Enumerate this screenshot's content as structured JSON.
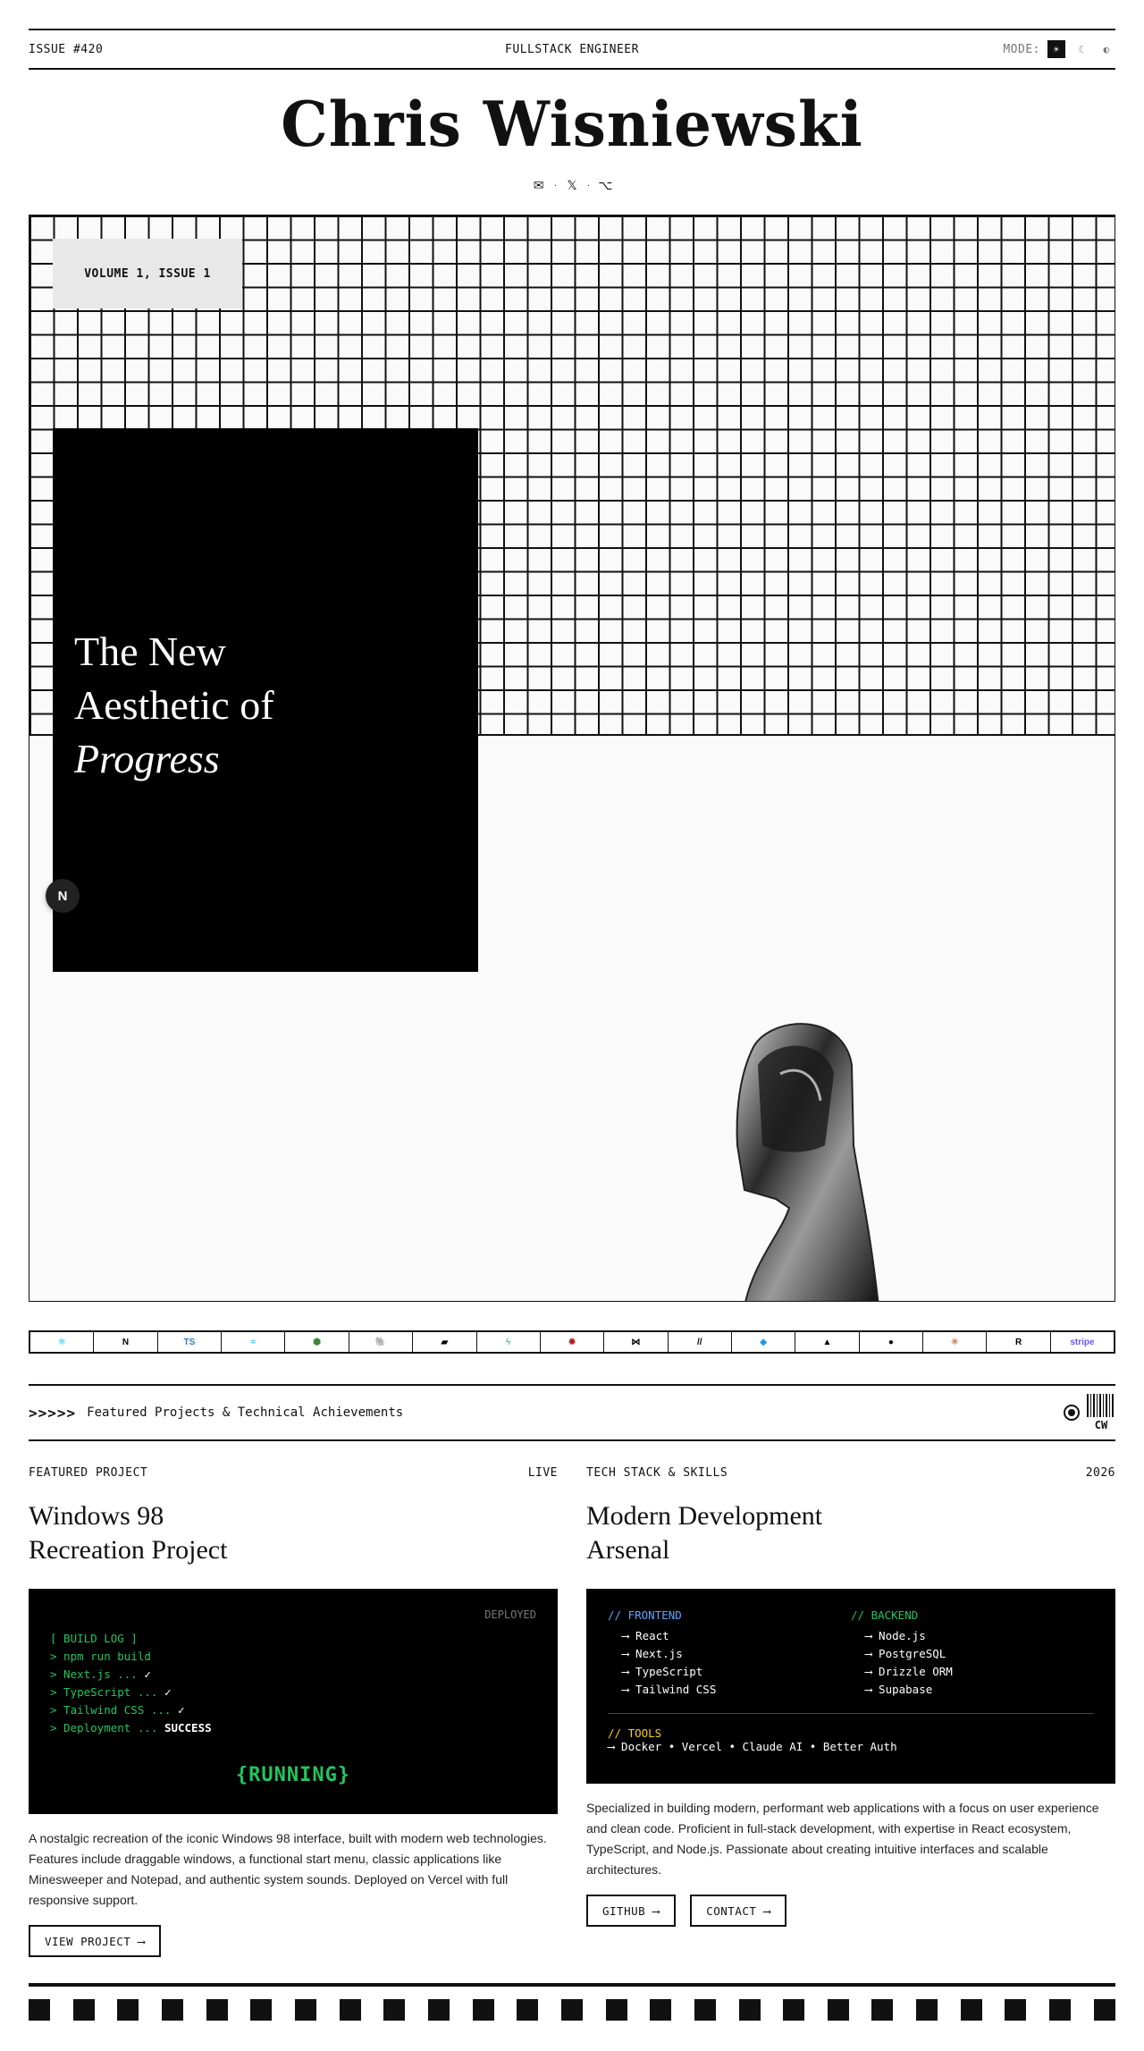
{
  "topbar": {
    "issue": "ISSUE #420",
    "role": "FULLSTACK ENGINEER",
    "mode_label": "MODE:",
    "mode_options": [
      "☀",
      "☾",
      "◐"
    ]
  },
  "masthead": {
    "name": "Chris Wisniewski"
  },
  "social": {
    "icons": [
      "✉",
      "𝕏",
      "⌥"
    ],
    "separator": "·"
  },
  "hero": {
    "volume": "VOLUME 1, ISSUE 1",
    "headline_line1": "The New",
    "headline_line2": "Aesthetic of",
    "headline_line3": "Progress",
    "float_button": "N"
  },
  "tech_strip": [
    {
      "name": "react-icon",
      "glyph": "⚛",
      "color": "#61dafb"
    },
    {
      "name": "nextjs-icon",
      "glyph": "N",
      "color": "#000000"
    },
    {
      "name": "typescript-icon",
      "glyph": "TS",
      "color": "#3178c6"
    },
    {
      "name": "tailwind-icon",
      "glyph": "≈",
      "color": "#38bdf8"
    },
    {
      "name": "nodejs-icon",
      "glyph": "⬢",
      "color": "#3c873a"
    },
    {
      "name": "postgresql-icon",
      "glyph": "🐘",
      "color": "#336791"
    },
    {
      "name": "analytics-icon",
      "glyph": "▰",
      "color": "#000000"
    },
    {
      "name": "supabase-icon",
      "glyph": "ϟ",
      "color": "#3ecf8e"
    },
    {
      "name": "settings-icon",
      "glyph": "✹",
      "color": "#b91c1c"
    },
    {
      "name": "drizzle-icon",
      "glyph": "⋈",
      "color": "#000000"
    },
    {
      "name": "slash-icon",
      "glyph": "//",
      "color": "#000000"
    },
    {
      "name": "docker-icon",
      "glyph": "◆",
      "color": "#2496ed"
    },
    {
      "name": "vercel-icon",
      "glyph": "▲",
      "color": "#000000"
    },
    {
      "name": "github-icon",
      "glyph": "●",
      "color": "#000000"
    },
    {
      "name": "claude-icon",
      "glyph": "✳",
      "color": "#d97757"
    },
    {
      "name": "resend-icon",
      "glyph": "R",
      "color": "#000000"
    },
    {
      "name": "stripe-icon",
      "glyph": "stripe",
      "color": "#635bff"
    }
  ],
  "featured_bar": {
    "arrows": ">>>>>",
    "text": "Featured Projects & Technical Achievements",
    "barcode_label": "CW"
  },
  "featured": {
    "label": "FEATURED PROJECT",
    "status": "LIVE",
    "title_line1": "Windows 98",
    "title_line2": "Recreation Project",
    "term_status": "DEPLOYED",
    "log": {
      "header": "[ BUILD LOG ]",
      "l1": "> npm run build",
      "l2": "> Next.js ... ",
      "l3": "> TypeScript ... ",
      "l4": "> Tailwind CSS ... ",
      "l5": "> Deployment ... ",
      "check": "✓",
      "success": "SUCCESS"
    },
    "running": "{RUNNING}",
    "description": "A nostalgic recreation of the iconic Windows 98 interface, built with modern web technologies. Features include draggable windows, a functional start menu, classic applications like Minesweeper and Notepad, and authentic system sounds. Deployed on Vercel with full responsive support.",
    "button": "VIEW PROJECT ⟶"
  },
  "skills": {
    "label": "TECH STACK & SKILLS",
    "year": "2026",
    "title_line1": "Modern Development",
    "title_line2": "Arsenal",
    "frontend_head": "// FRONTEND",
    "frontend": [
      "⟶ React",
      "⟶ Next.js",
      "⟶ TypeScript",
      "⟶ Tailwind CSS"
    ],
    "backend_head": "// BACKEND",
    "backend": [
      "⟶ Node.js",
      "⟶ PostgreSQL",
      "⟶ Drizzle ORM",
      "⟶ Supabase"
    ],
    "tools_head": "// TOOLS",
    "tools": "⟶ Docker • Vercel • Claude AI • Better Auth",
    "description": "Specialized in building modern, performant web applications with a focus on user experience and clean code. Proficient in full-stack development, with expertise in React ecosystem, TypeScript, and Node.js. Passionate about creating intuitive interfaces and scalable architectures.",
    "github_button": "GITHUB ⟶",
    "contact_button": "CONTACT ⟶"
  }
}
